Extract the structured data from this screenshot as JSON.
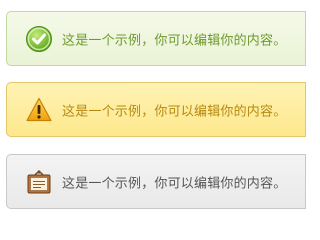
{
  "messages": [
    {
      "type": "success",
      "icon": "check-circle-icon",
      "text": "这是一个示例，你可以编辑你的内容。",
      "color": "#6d9a2e"
    },
    {
      "type": "warning",
      "icon": "warning-triangle-icon",
      "text": "这是一个示例，你可以编辑你的内容。",
      "color": "#b58910"
    },
    {
      "type": "neutral",
      "icon": "note-clipboard-icon",
      "text": "这是一个示例，你可以编辑你的内容。",
      "color": "#555555"
    }
  ]
}
